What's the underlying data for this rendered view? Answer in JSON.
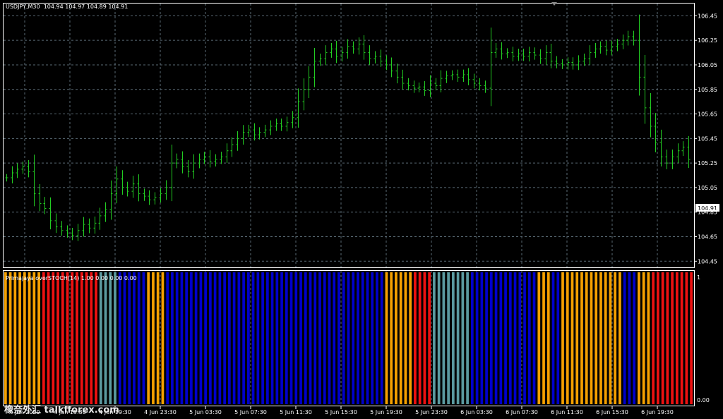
{
  "header": {
    "symbol": "USDJPY,M30",
    "ohlc": "104.94 104.97 104.89 104.91"
  },
  "indicator": {
    "label": "Primajaya overSTOCH(14) 1.00 0.00 0.00 0.00",
    "scale_top": "1",
    "scale_bottom": "0.00"
  },
  "current_price": "104.91",
  "watermark": "橡奈外汇 talkfforex.com",
  "colors": {
    "background": "#000000",
    "grid": "#5a6a75",
    "axis": "#ffffff",
    "candle": "#22cc22",
    "state_orange": "#f5a000",
    "state_red": "#ee1111",
    "state_teal": "#5b9aa0",
    "state_blue": "#0000cc"
  },
  "chart_data": {
    "type": "ohlc",
    "title": "USDJPY,M30",
    "ylim": [
      104.4,
      106.55
    ],
    "y_ticks": [
      "106.45",
      "106.25",
      "106.05",
      "105.85",
      "105.65",
      "105.45",
      "105.25",
      "105.05",
      "104.85",
      "104.65",
      "104.45"
    ],
    "x_ticks": [
      "4 Jun 2020",
      "4 Jun 15:30",
      "4 Jun 19:30",
      "4 Jun 23:30",
      "5 Jun 03:30",
      "5 Jun 07:30",
      "5 Jun 11:30",
      "5 Jun 15:30",
      "5 Jun 19:30",
      "5 Jun 23:30",
      "6 Jun 03:30",
      "6 Jun 07:30",
      "6 Jun 11:30",
      "6 Jun 15:30",
      "6 Jun 19:30"
    ],
    "grid": true,
    "closes": [
      105.13,
      105.17,
      105.2,
      105.22,
      105.18,
      105.0,
      104.92,
      104.88,
      104.78,
      104.73,
      104.7,
      104.68,
      104.66,
      104.7,
      104.75,
      104.72,
      104.76,
      104.82,
      104.87,
      105.0,
      105.12,
      105.05,
      105.02,
      105.08,
      105.0,
      104.98,
      104.95,
      104.97,
      105.0,
      105.05,
      105.25,
      105.28,
      105.22,
      105.18,
      105.25,
      105.28,
      105.3,
      105.26,
      105.28,
      105.3,
      105.35,
      105.4,
      105.45,
      105.5,
      105.52,
      105.48,
      105.5,
      105.52,
      105.55,
      105.57,
      105.55,
      105.58,
      105.62,
      105.75,
      105.85,
      105.95,
      106.08,
      106.1,
      106.15,
      106.18,
      106.12,
      106.15,
      106.2,
      106.18,
      106.22,
      106.15,
      106.1,
      106.12,
      106.08,
      106.05,
      106.0,
      105.95,
      105.9,
      105.88,
      105.86,
      105.87,
      105.84,
      105.9,
      105.88,
      105.94,
      105.96,
      105.97,
      105.95,
      105.97,
      105.93,
      105.9,
      105.88,
      105.86,
      106.15,
      106.18,
      106.14,
      106.15,
      106.12,
      106.14,
      106.12,
      106.15,
      106.13,
      106.1,
      106.15,
      106.08,
      106.06,
      106.05,
      106.07,
      106.05,
      106.08,
      106.1,
      106.15,
      106.18,
      106.2,
      106.17,
      106.2,
      106.22,
      106.25,
      106.28,
      106.25,
      105.95,
      105.7,
      105.55,
      105.42,
      105.3,
      105.25,
      105.3,
      105.35,
      105.38,
      105.28
    ],
    "indicator_states": [
      "orange",
      "orange",
      "orange",
      "orange",
      "orange",
      "orange",
      "orange",
      "orange",
      "red",
      "red",
      "red",
      "red",
      "red",
      "red",
      "red",
      "red",
      "red",
      "red",
      "red",
      "red",
      "teal",
      "teal",
      "teal",
      "teal",
      "blue",
      "blue",
      "blue",
      "blue",
      "blue",
      "blue",
      "orange",
      "orange",
      "orange",
      "orange",
      "blue",
      "blue",
      "blue",
      "blue",
      "blue",
      "blue",
      "blue",
      "blue",
      "blue",
      "blue",
      "blue",
      "blue",
      "blue",
      "blue",
      "blue",
      "blue",
      "blue",
      "blue",
      "blue",
      "blue",
      "blue",
      "blue",
      "blue",
      "blue",
      "blue",
      "blue",
      "blue",
      "blue",
      "blue",
      "blue",
      "blue",
      "blue",
      "blue",
      "blue",
      "blue",
      "blue",
      "blue",
      "blue",
      "blue",
      "blue",
      "blue",
      "blue",
      "blue",
      "blue",
      "blue",
      "blue",
      "orange",
      "orange",
      "orange",
      "orange",
      "orange",
      "orange",
      "red",
      "red",
      "red",
      "red",
      "teal",
      "teal",
      "teal",
      "teal",
      "teal",
      "teal",
      "teal",
      "teal",
      "blue",
      "blue",
      "blue",
      "blue",
      "blue",
      "blue",
      "blue",
      "blue",
      "blue",
      "blue",
      "blue",
      "blue",
      "blue",
      "blue",
      "orange",
      "orange",
      "orange",
      "blue",
      "blue",
      "orange",
      "orange",
      "orange",
      "orange",
      "orange",
      "orange",
      "orange",
      "orange",
      "orange",
      "orange",
      "orange",
      "orange",
      "orange",
      "blue",
      "blue",
      "blue",
      "orange",
      "orange",
      "orange",
      "red",
      "red",
      "red",
      "red",
      "red",
      "red",
      "red",
      "red",
      "red"
    ]
  }
}
